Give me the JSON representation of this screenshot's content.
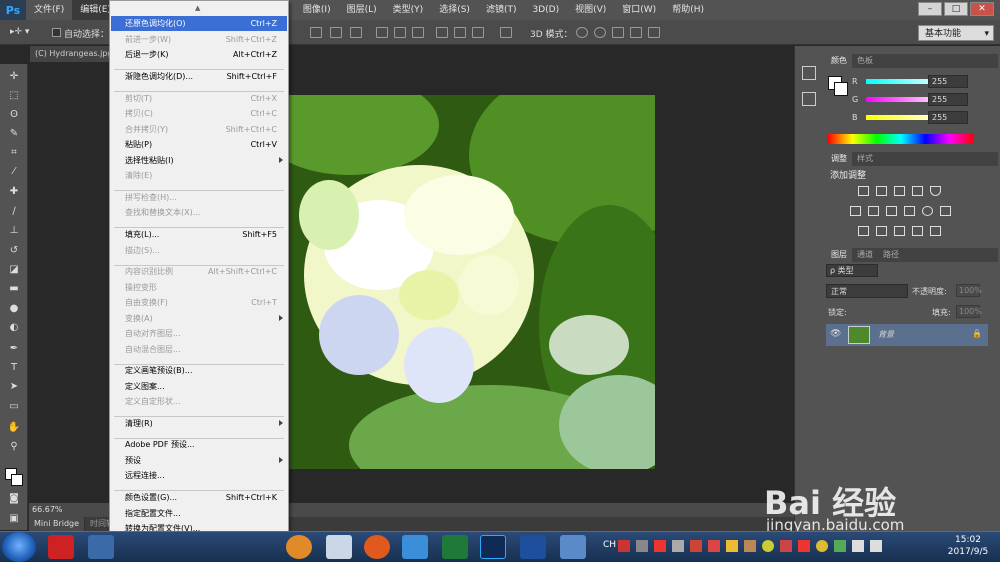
{
  "menubar": {
    "logo": "Ps",
    "items": [
      "文件(F)",
      "编辑(E)",
      "图像(I)",
      "图层(L)",
      "类型(Y)",
      "选择(S)",
      "滤镜(T)",
      "3D(D)",
      "视图(V)",
      "窗口(W)",
      "帮助(H)"
    ],
    "window_controls": [
      "–",
      "□",
      "✕"
    ]
  },
  "optbar": {
    "auto_select_label": "自动选择：",
    "mode_3d_label": "3D 模式：",
    "workspace": "基本功能"
  },
  "document": {
    "tab_title": "(C) Hydrangeas.jpg",
    "zoom": "66.67%"
  },
  "bridge": {
    "tabs": [
      "Mini Bridge",
      "时间轴"
    ]
  },
  "edit_menu": {
    "items": [
      {
        "label": "还原色调均化(O)",
        "shortcut": "Ctrl+Z",
        "state": "highlight"
      },
      {
        "label": "前进一步(W)",
        "shortcut": "Shift+Ctrl+Z",
        "state": "disabled"
      },
      {
        "label": "后退一步(K)",
        "shortcut": "Alt+Ctrl+Z",
        "state": "enabled"
      },
      {
        "label": "渐隐色调均化(D)...",
        "shortcut": "Shift+Ctrl+F",
        "state": "enabled"
      },
      {
        "label": "剪切(T)",
        "shortcut": "Ctrl+X",
        "state": "disabled"
      },
      {
        "label": "拷贝(C)",
        "shortcut": "Ctrl+C",
        "state": "disabled"
      },
      {
        "label": "合并拷贝(Y)",
        "shortcut": "Shift+Ctrl+C",
        "state": "disabled"
      },
      {
        "label": "粘贴(P)",
        "shortcut": "Ctrl+V",
        "state": "enabled"
      },
      {
        "label": "选择性粘贴(I)",
        "shortcut": "",
        "state": "enabled",
        "submenu": true
      },
      {
        "label": "清除(E)",
        "shortcut": "",
        "state": "disabled"
      },
      {
        "label": "拼写检查(H)...",
        "shortcut": "",
        "state": "disabled"
      },
      {
        "label": "查找和替换文本(X)...",
        "shortcut": "",
        "state": "disabled"
      },
      {
        "label": "填充(L)...",
        "shortcut": "Shift+F5",
        "state": "enabled"
      },
      {
        "label": "描边(S)...",
        "shortcut": "",
        "state": "disabled"
      },
      {
        "label": "内容识别比例",
        "shortcut": "Alt+Shift+Ctrl+C",
        "state": "disabled"
      },
      {
        "label": "操控变形",
        "shortcut": "",
        "state": "disabled"
      },
      {
        "label": "自由变换(F)",
        "shortcut": "Ctrl+T",
        "state": "disabled"
      },
      {
        "label": "变换(A)",
        "shortcut": "",
        "state": "disabled",
        "submenu": true
      },
      {
        "label": "自动对齐图层...",
        "shortcut": "",
        "state": "disabled"
      },
      {
        "label": "自动混合图层...",
        "shortcut": "",
        "state": "disabled"
      },
      {
        "label": "定义画笔预设(B)...",
        "shortcut": "",
        "state": "enabled"
      },
      {
        "label": "定义图案...",
        "shortcut": "",
        "state": "enabled"
      },
      {
        "label": "定义自定形状...",
        "shortcut": "",
        "state": "disabled"
      },
      {
        "label": "清理(R)",
        "shortcut": "",
        "state": "enabled",
        "submenu": true
      },
      {
        "label": "Adobe PDF 预设...",
        "shortcut": "",
        "state": "enabled"
      },
      {
        "label": "预设",
        "shortcut": "",
        "state": "enabled",
        "submenu": true
      },
      {
        "label": "远程连接...",
        "shortcut": "",
        "state": "enabled"
      },
      {
        "label": "颜色设置(G)...",
        "shortcut": "Shift+Ctrl+K",
        "state": "enabled"
      },
      {
        "label": "指定配置文件...",
        "shortcut": "",
        "state": "enabled"
      },
      {
        "label": "转换为配置文件(V)...",
        "shortcut": "",
        "state": "enabled"
      }
    ]
  },
  "color_panel": {
    "tabs": [
      "颜色",
      "色板"
    ],
    "channels": [
      {
        "name": "R",
        "value": "255",
        "color": "#ff3b3b"
      },
      {
        "name": "G",
        "value": "255",
        "color": "#3bff3b"
      },
      {
        "name": "B",
        "value": "255",
        "color": "#3b3bff"
      }
    ]
  },
  "adjust_panel": {
    "tabs": [
      "调整",
      "样式"
    ],
    "title": "添加调整"
  },
  "layers_panel": {
    "tabs": [
      "图层",
      "通道",
      "路径"
    ],
    "filter": "ρ 类型",
    "blend_mode": "正常",
    "opacity_label": "不透明度:",
    "opacity": "100%",
    "lock_label": "锁定:",
    "fill_label": "填充:",
    "fill": "100%",
    "layer_name": "背景"
  },
  "taskbar": {
    "tray_lang": "CH",
    "time": "15:02",
    "date": "2017/9/5"
  },
  "watermark": {
    "brand": "Bai 经验",
    "url": "jingyan.baidu.com"
  }
}
